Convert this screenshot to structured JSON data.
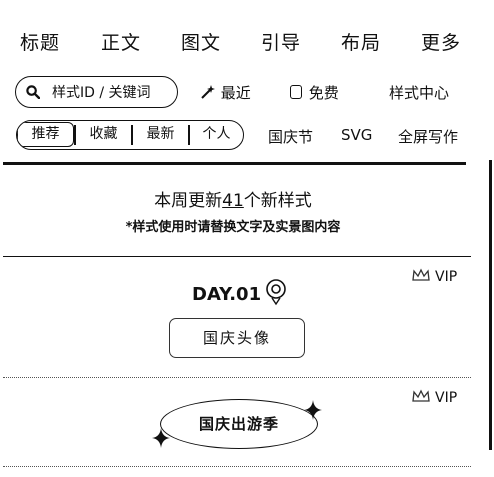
{
  "nav": {
    "items": [
      "标题",
      "正文",
      "图文",
      "引导",
      "布局",
      "更多"
    ]
  },
  "search": {
    "placeholder": "样式ID / 关键词"
  },
  "filters": {
    "recent": "最近",
    "free": "免费",
    "style_center": "样式中心"
  },
  "tabs": {
    "segments": [
      "推荐",
      "收藏",
      "最新",
      "个人"
    ],
    "active_index": 0,
    "categories": [
      "国庆节",
      "SVG",
      "全屏写作"
    ]
  },
  "update": {
    "prefix": "本周更新",
    "count": "41",
    "suffix": "个新样式",
    "note": "*样式使用时请替换文字及实景图内容"
  },
  "cards": [
    {
      "vip": "VIP",
      "title": "DAY.01",
      "button_text": "国庆头像"
    },
    {
      "vip": "VIP",
      "oval_text": "国庆出游季"
    }
  ]
}
